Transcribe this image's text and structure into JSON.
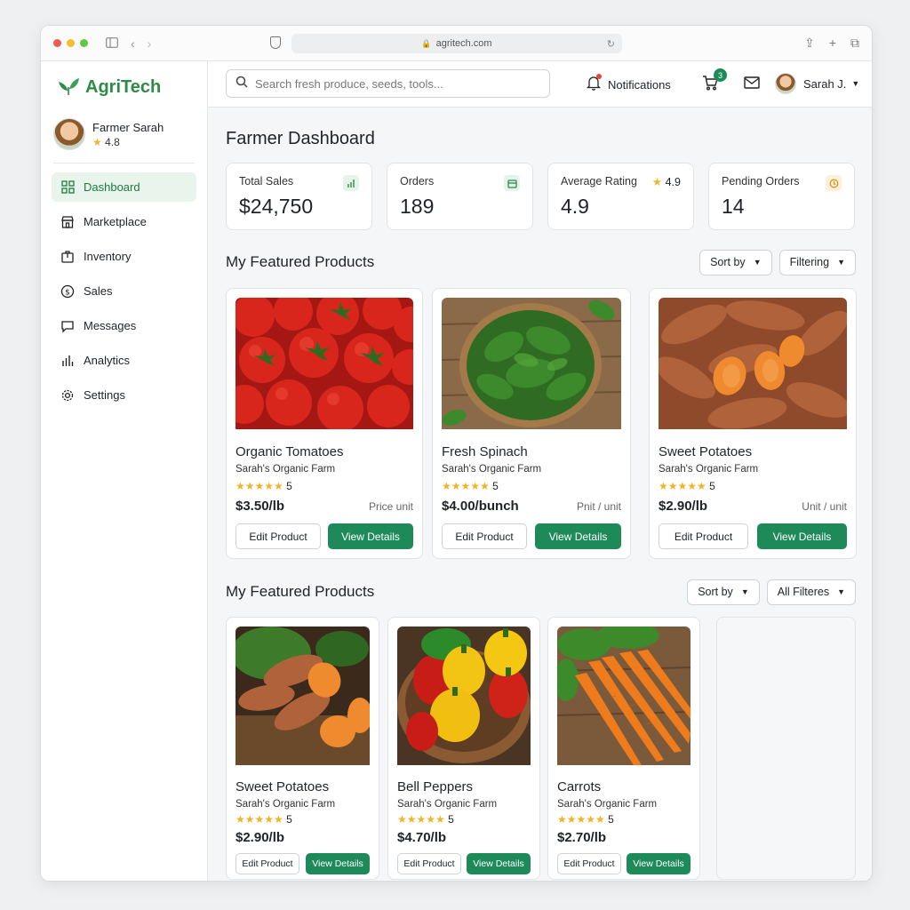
{
  "browser": {
    "url": "agritech.com"
  },
  "brand": {
    "name": "AgriTech",
    "color": "#2e8b45"
  },
  "sidebar": {
    "profile": {
      "name": "Farmer Sarah",
      "rating": "4.8"
    },
    "items": [
      {
        "label": "Dashboard",
        "icon": "grid-icon",
        "active": true
      },
      {
        "label": "Marketplace",
        "icon": "store-icon"
      },
      {
        "label": "Inventory",
        "icon": "box-icon"
      },
      {
        "label": "Sales",
        "icon": "dollar-icon"
      },
      {
        "label": "Messages",
        "icon": "message-icon"
      },
      {
        "label": "Analytics",
        "icon": "bar-chart-icon"
      },
      {
        "label": "Settings",
        "icon": "gear-icon"
      }
    ]
  },
  "topbar": {
    "search_placeholder": "Search fresh produce, seeds, tools...",
    "notifications_label": "Notifications",
    "cart_count": "3",
    "user_name": "Sarah J."
  },
  "dashboard": {
    "title": "Farmer Dashboard",
    "stats": [
      {
        "label": "Total Sales",
        "value": "$24,750",
        "icon": "chart-icon"
      },
      {
        "label": "Orders",
        "value": "189",
        "icon": "calendar-icon"
      },
      {
        "label": "Average Rating",
        "badge": "4.9",
        "value": "4.9",
        "icon": "star-icon"
      },
      {
        "label": "Pending Orders",
        "value": "14",
        "icon": "clock-icon"
      }
    ]
  },
  "section1": {
    "title": "My Featured Products",
    "sort_label": "Sort by",
    "filter_label": "Filtering",
    "products": [
      {
        "name": "Organic Tomatoes",
        "farm": "Sarah's Organic Farm",
        "rating": "5",
        "price": "$3.50/lb",
        "unit": "Price unit",
        "edit": "Edit Product",
        "view": "View Details"
      },
      {
        "name": "Fresh Spinach",
        "farm": "Sarah's Organic Farm",
        "rating": "5",
        "price": "$4.00/bunch",
        "unit": "Pnit / unit",
        "edit": "Edit Product",
        "view": "View Details"
      },
      {
        "name": "Sweet Potatoes",
        "farm": "Sarah's Organic Farm",
        "rating": "5",
        "price": "$2.90/lb",
        "unit": "Unit / unit",
        "edit": "Edit Product",
        "view": "View Details"
      }
    ]
  },
  "section2": {
    "title": "My Featured Products",
    "sort_label": "Sort by",
    "filter_label": "All Filteres",
    "products": [
      {
        "name": "Sweet Potatoes",
        "farm": "Sarah's Organic Farm",
        "rating": "5",
        "price": "$2.90/lb",
        "edit": "Edit Product",
        "view": "View Details"
      },
      {
        "name": "Bell Peppers",
        "farm": "Sarah's Organic Farm",
        "rating": "5",
        "price": "$4.70/lb",
        "edit": "Edit Product",
        "view": "View Details"
      },
      {
        "name": "Carrots",
        "farm": "Sarah's Organic Farm",
        "rating": "5",
        "price": "$2.70/lb",
        "edit": "Edit Product",
        "view": "View Details"
      }
    ]
  },
  "colors": {
    "accent": "#1e8a5a",
    "star": "#f0b429",
    "active_bg": "#e9f4ec"
  }
}
